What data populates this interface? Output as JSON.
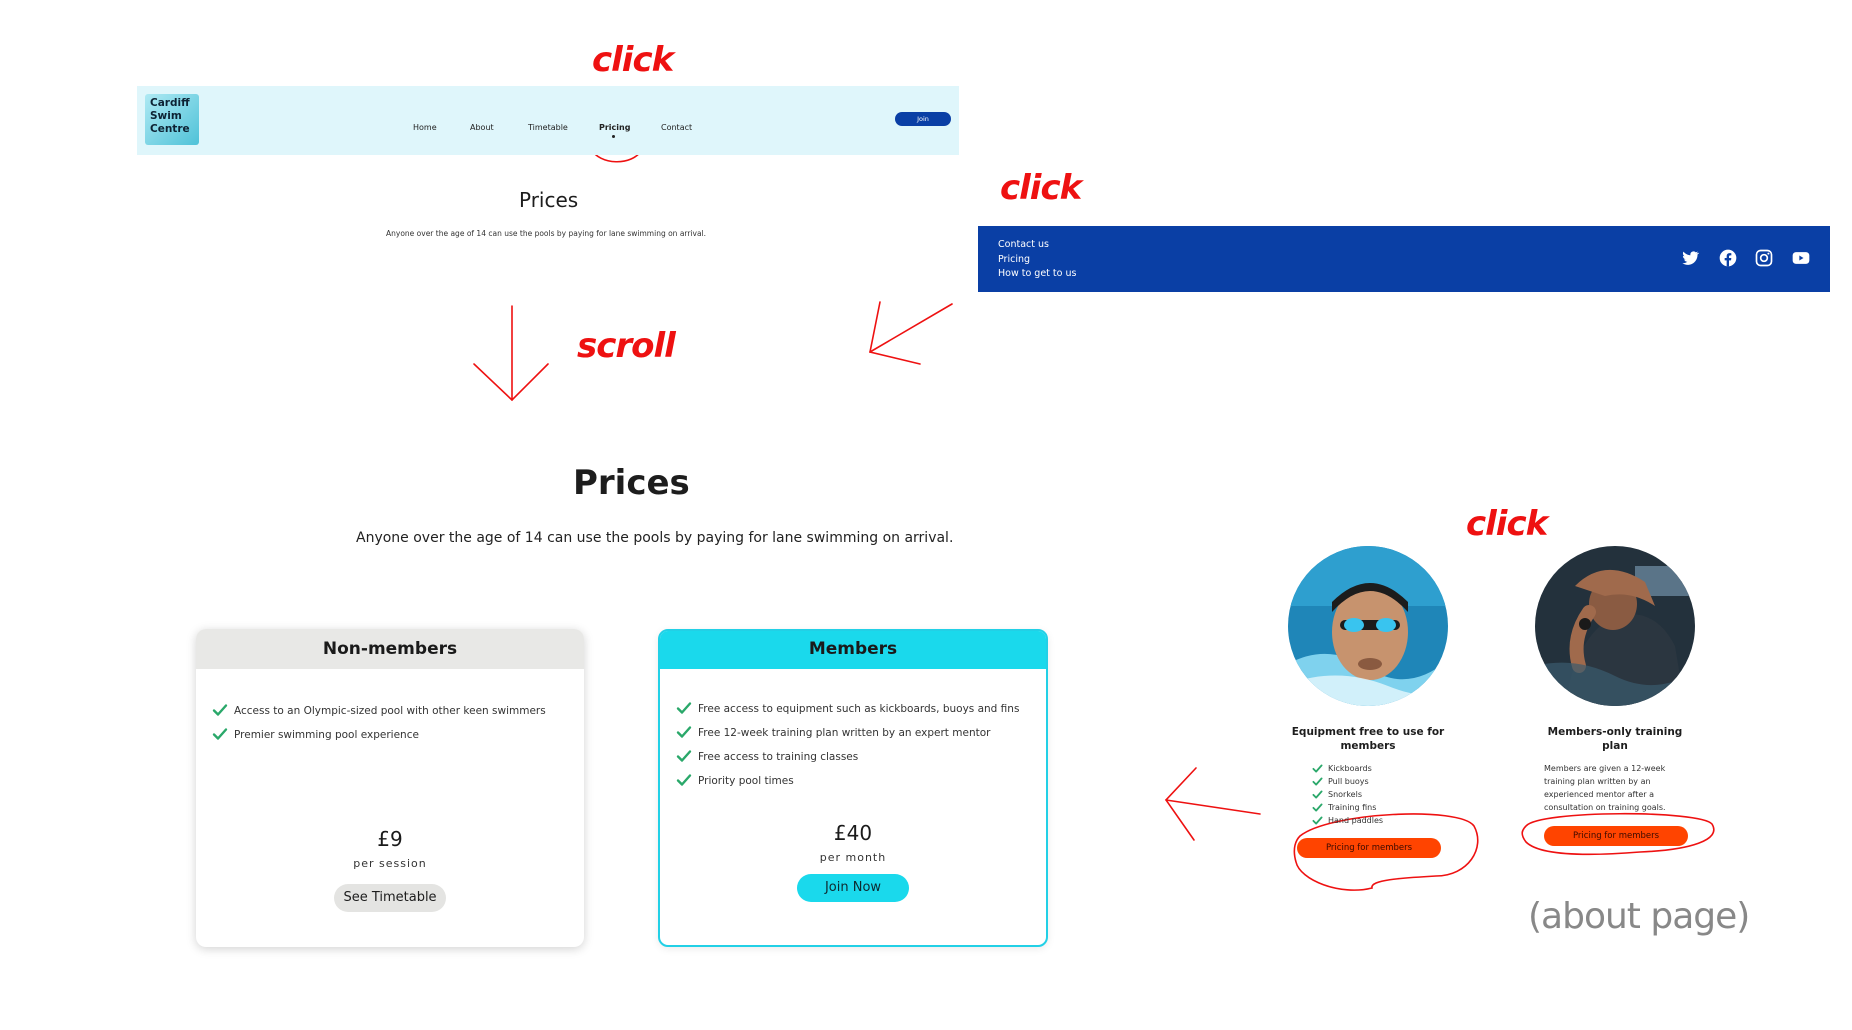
{
  "annotations": {
    "click_top": "click",
    "click_footer": "click",
    "scroll": "scroll",
    "click_about": "click",
    "about_label": "(about page)"
  },
  "nav": {
    "logo_lines": [
      "Cardiff",
      "Swim",
      "Centre"
    ],
    "links": [
      "Home",
      "About",
      "Timetable",
      "Pricing",
      "Contact"
    ],
    "join": "Join"
  },
  "small_prices": {
    "title": "Prices",
    "subtitle": "Anyone over the age of 14 can use the pools by paying for lane swimming on arrival."
  },
  "footer": {
    "links": [
      "Contact us",
      "Pricing",
      "How to get to us"
    ],
    "icons": [
      "twitter-icon",
      "facebook-icon",
      "instagram-icon",
      "youtube-icon"
    ],
    "bg_color": "#0a3fa5"
  },
  "prices": {
    "title": "Prices",
    "subtitle": "Anyone over the age of 14 can use the pools by paying for lane swimming on arrival.",
    "cards": [
      {
        "title": "Non-members",
        "features": [
          "Access to an Olympic-sized pool with other keen swimmers",
          "Premier swimming pool experience"
        ],
        "price": "£9",
        "period": "per session",
        "button": "See Timetable"
      },
      {
        "title": "Members",
        "features": [
          "Free access to equipment such as kickboards, buoys and fins",
          "Free 12-week training plan written by an expert mentor",
          "Free access to training classes",
          "Priority pool times"
        ],
        "price": "£40",
        "period": "per month",
        "button": "Join Now"
      }
    ]
  },
  "about": {
    "col1": {
      "title_lines": [
        "Equipment free to use for",
        "members"
      ],
      "items": [
        "Kickboards",
        "Pull buoys",
        "Snorkels",
        "Training fins",
        "Hand paddles"
      ],
      "button": "Pricing for members"
    },
    "col2": {
      "title_lines": [
        "Members-only training",
        "plan"
      ],
      "para_lines": [
        "Members are given a 12-week",
        "training plan written by an",
        "experienced mentor after a",
        "consultation on training goals."
      ],
      "button": "Pricing for members"
    }
  },
  "colors": {
    "accent_cyan": "#1ad9ec",
    "brand_blue": "#0a3fa5",
    "check_green": "#2aa86a",
    "orange": "#ff4400",
    "annotation_red": "#ee1111"
  }
}
